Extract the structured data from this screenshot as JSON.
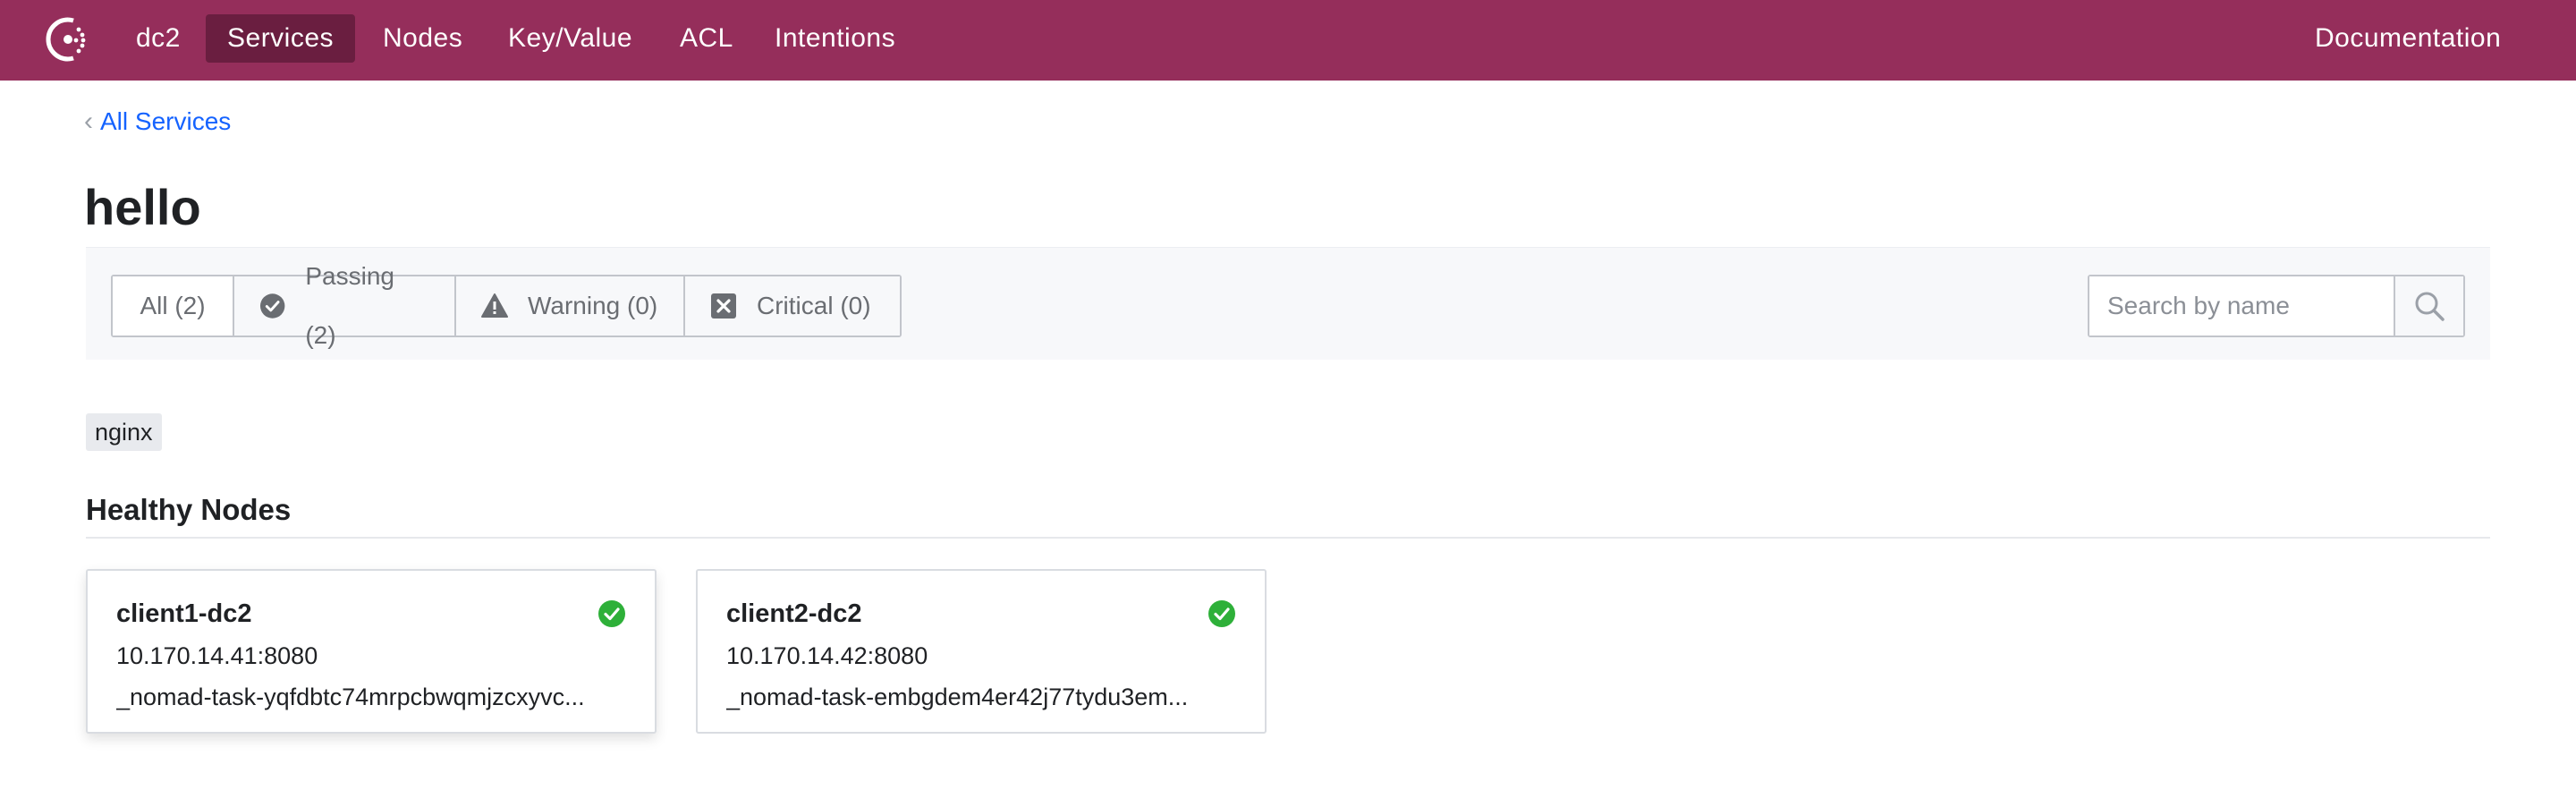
{
  "nav": {
    "datacenter": "dc2",
    "items": [
      {
        "label": "Services"
      },
      {
        "label": "Nodes"
      },
      {
        "label": "Key/Value"
      },
      {
        "label": "ACL"
      },
      {
        "label": "Intentions"
      }
    ],
    "active": "Services",
    "documentation": "Documentation",
    "logo_icon": "consul-logo-icon"
  },
  "breadcrumb": {
    "label": "All Services",
    "icon": "chevron-left-icon"
  },
  "page": {
    "title": "hello"
  },
  "filters": {
    "tabs": [
      {
        "label": "All (2)",
        "icon": null,
        "selected": true
      },
      {
        "label": "Passing (2)",
        "icon": "check-circle-icon"
      },
      {
        "label": "Warning (0)",
        "icon": "warning-triangle-icon"
      },
      {
        "label": "Critical (0)",
        "icon": "critical-x-icon"
      }
    ],
    "search": {
      "placeholder": "Search by name",
      "value": "",
      "icon": "search-icon"
    }
  },
  "tags": [
    "nginx"
  ],
  "healthy_nodes": {
    "title": "Healthy Nodes",
    "cards": [
      {
        "name": "client1-dc2",
        "address": "10.170.14.41:8080",
        "service_id": "_nomad-task-yqfdbtc74mrpcbwqmjzcxyvc...",
        "status_icon": "passing-check-icon"
      },
      {
        "name": "client2-dc2",
        "address": "10.170.14.42:8080",
        "service_id": "_nomad-task-embgdem4er42j77tydu3em...",
        "status_icon": "passing-check-icon"
      }
    ]
  },
  "colors": {
    "brand": "#952e5b",
    "brand_active": "#6a1e40",
    "link": "#1563ff",
    "passing": "#2eb039"
  }
}
